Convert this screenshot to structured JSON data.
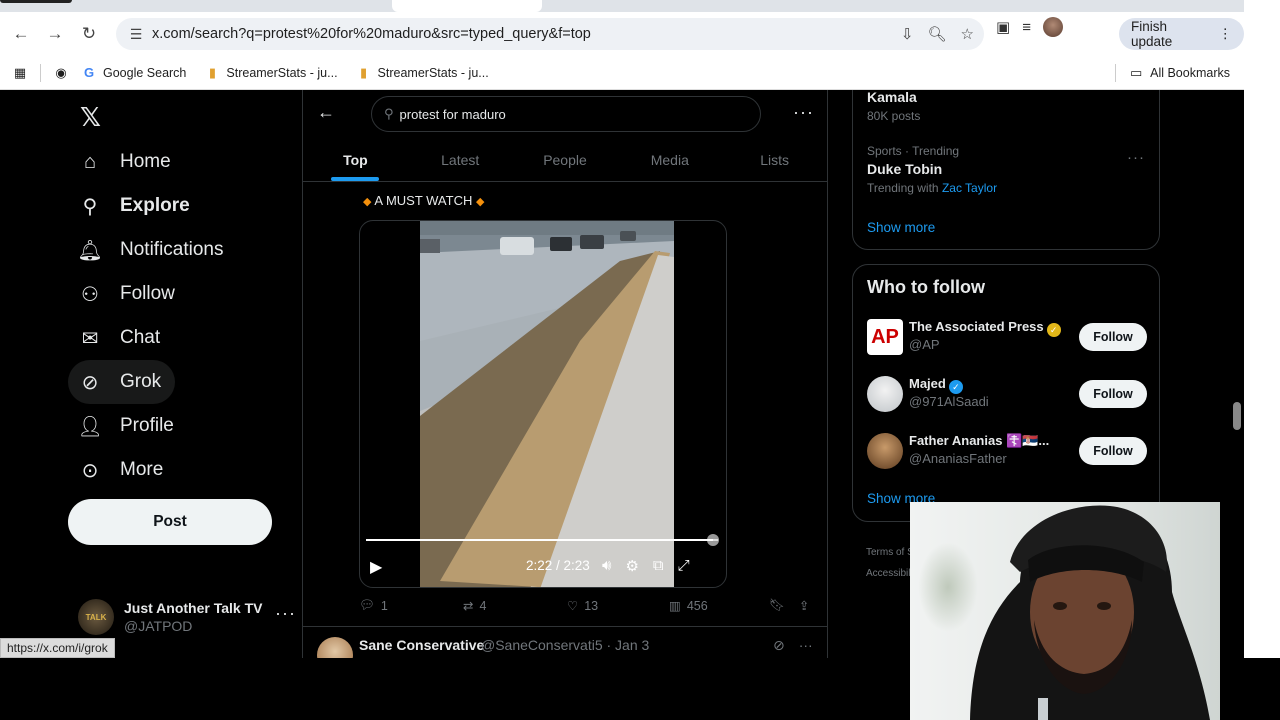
{
  "browser": {
    "url": "x.com/search?q=protest%20for%20maduro&src=typed_query&f=top",
    "finish_update": "Finish update",
    "bookmarks": [
      {
        "label": "Google Search",
        "icon": "google-icon"
      },
      {
        "label": "StreamerStats - ju...",
        "icon": "bar-chart-icon"
      },
      {
        "label": "StreamerStats - ju...",
        "icon": "bar-chart-icon"
      }
    ],
    "all_bookmarks": "All Bookmarks",
    "status_url": "https://x.com/i/grok"
  },
  "nav": {
    "items": [
      {
        "label": "Home",
        "icon": "home-icon"
      },
      {
        "label": "Explore",
        "icon": "search-icon"
      },
      {
        "label": "Notifications",
        "icon": "bell-icon"
      },
      {
        "label": "Follow",
        "icon": "person-add-icon"
      },
      {
        "label": "Chat",
        "icon": "mail-icon"
      },
      {
        "label": "Grok",
        "icon": "grok-icon"
      },
      {
        "label": "Profile",
        "icon": "person-icon"
      },
      {
        "label": "More",
        "icon": "more-circle-icon"
      }
    ],
    "post_label": "Post",
    "account": {
      "name": "Just Another Talk TV",
      "handle": "@JATPOD",
      "avatar_text": "TALK"
    }
  },
  "search": {
    "query": "protest for maduro",
    "tabs": [
      "Top",
      "Latest",
      "People",
      "Media",
      "Lists"
    ],
    "active_tab": "Top"
  },
  "post": {
    "caption": "A MUST WATCH",
    "video": {
      "time": "2:22 / 2:23",
      "progress": 0.985
    },
    "stats": {
      "replies": "1",
      "reposts": "4",
      "likes": "13",
      "views": "456"
    }
  },
  "next_post": {
    "name": "Sane Conservative",
    "handle": "@SaneConservati5 · Jan 3"
  },
  "trends": {
    "top_title": "Kamala",
    "top_count": "80K posts",
    "item": {
      "category": "Sports · Trending",
      "title": "Duke Tobin",
      "trending_with_label": "Trending with",
      "trending_with": "Zac Taylor"
    },
    "show_more": "Show more"
  },
  "who_to_follow": {
    "title": "Who to follow",
    "accounts": [
      {
        "name": "The Associated Press",
        "handle": "@AP",
        "badge": "gold"
      },
      {
        "name": "Majed",
        "handle": "@971AlSaadi",
        "badge": "blue"
      },
      {
        "name": "Father Ananias ☦️🇷🇸...",
        "handle": "@AnaniasFather",
        "badge": ""
      }
    ],
    "follow_label": "Follow",
    "show_more": "Show more"
  },
  "footer": {
    "line1": "Terms of S",
    "line2": "Accessibil"
  },
  "colors": {
    "accent": "#1d9bf0",
    "background": "#000000",
    "border": "#2f3336",
    "muted": "#71767b"
  }
}
